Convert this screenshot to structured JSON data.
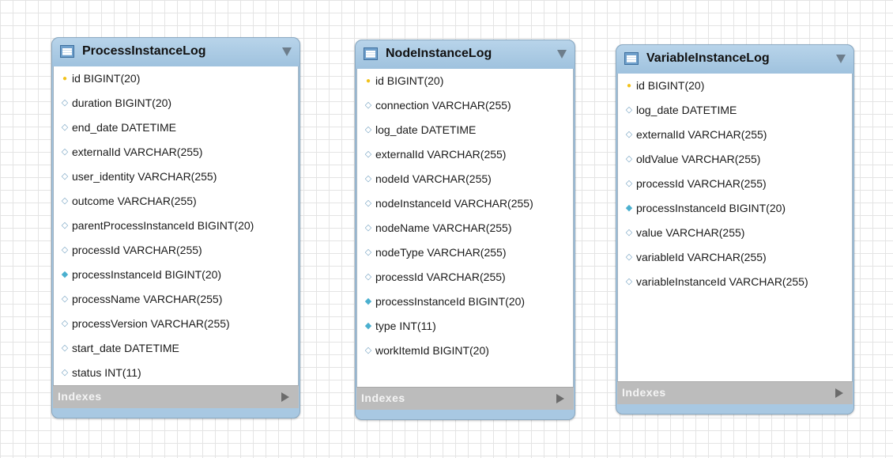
{
  "tables": [
    {
      "title": "ProcessInstanceLog",
      "indexes_label": "Indexes",
      "columns": [
        {
          "icon": "primary-key-icon",
          "text": "id BIGINT(20)"
        },
        {
          "icon": "column-icon",
          "text": "duration BIGINT(20)"
        },
        {
          "icon": "column-icon",
          "text": "end_date DATETIME"
        },
        {
          "icon": "column-icon",
          "text": "externalId VARCHAR(255)"
        },
        {
          "icon": "column-icon",
          "text": "user_identity VARCHAR(255)"
        },
        {
          "icon": "column-icon",
          "text": "outcome VARCHAR(255)"
        },
        {
          "icon": "column-icon",
          "text": "parentProcessInstanceId BIGINT(20)"
        },
        {
          "icon": "column-icon",
          "text": "processId VARCHAR(255)"
        },
        {
          "icon": "indexed-column-icon",
          "text": "processInstanceId BIGINT(20)"
        },
        {
          "icon": "column-icon",
          "text": "processName VARCHAR(255)"
        },
        {
          "icon": "column-icon",
          "text": "processVersion VARCHAR(255)"
        },
        {
          "icon": "column-icon",
          "text": "start_date DATETIME"
        },
        {
          "icon": "column-icon",
          "text": "status INT(11)"
        }
      ]
    },
    {
      "title": "NodeInstanceLog",
      "indexes_label": "Indexes",
      "columns": [
        {
          "icon": "primary-key-icon",
          "text": "id BIGINT(20)"
        },
        {
          "icon": "column-icon",
          "text": "connection VARCHAR(255)"
        },
        {
          "icon": "column-icon",
          "text": "log_date DATETIME"
        },
        {
          "icon": "column-icon",
          "text": "externalId VARCHAR(255)"
        },
        {
          "icon": "column-icon",
          "text": "nodeId VARCHAR(255)"
        },
        {
          "icon": "column-icon",
          "text": "nodeInstanceId VARCHAR(255)"
        },
        {
          "icon": "column-icon",
          "text": "nodeName VARCHAR(255)"
        },
        {
          "icon": "column-icon",
          "text": "nodeType VARCHAR(255)"
        },
        {
          "icon": "column-icon",
          "text": "processId VARCHAR(255)"
        },
        {
          "icon": "indexed-column-icon",
          "text": "processInstanceId BIGINT(20)"
        },
        {
          "icon": "indexed-column-icon",
          "text": "type INT(11)"
        },
        {
          "icon": "column-icon",
          "text": "workItemId BIGINT(20)"
        }
      ]
    },
    {
      "title": "VariableInstanceLog",
      "indexes_label": "Indexes",
      "columns": [
        {
          "icon": "primary-key-icon",
          "text": "id BIGINT(20)"
        },
        {
          "icon": "column-icon",
          "text": "log_date DATETIME"
        },
        {
          "icon": "column-icon",
          "text": "externalId VARCHAR(255)"
        },
        {
          "icon": "column-icon",
          "text": "oldValue VARCHAR(255)"
        },
        {
          "icon": "column-icon",
          "text": "processId VARCHAR(255)"
        },
        {
          "icon": "indexed-column-icon",
          "text": "processInstanceId BIGINT(20)"
        },
        {
          "icon": "column-icon",
          "text": "value VARCHAR(255)"
        },
        {
          "icon": "column-icon",
          "text": "variableId VARCHAR(255)"
        },
        {
          "icon": "column-icon",
          "text": "variableInstanceId VARCHAR(255)"
        }
      ]
    }
  ]
}
